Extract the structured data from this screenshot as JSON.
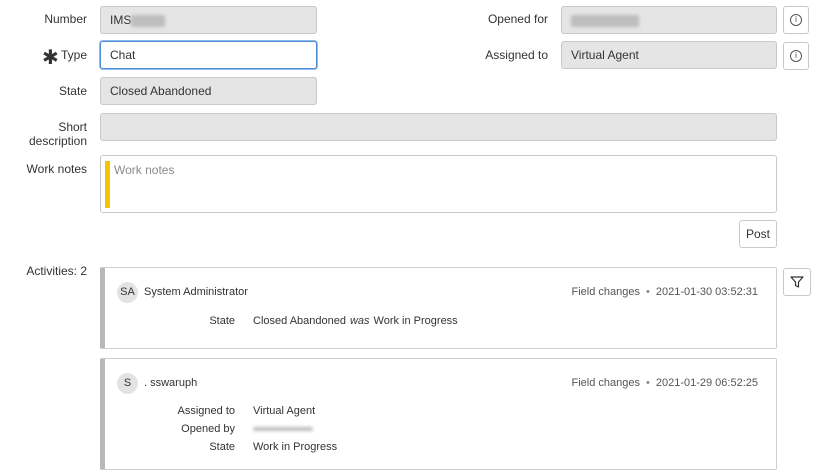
{
  "form": {
    "number": {
      "label": "Number",
      "value": "IMS"
    },
    "type": {
      "label": "Type",
      "value": "Chat",
      "required_mark": "✱"
    },
    "state": {
      "label": "State",
      "value": "Closed Abandoned"
    },
    "opened_for": {
      "label": "Opened for",
      "value": ""
    },
    "assigned_to": {
      "label": "Assigned to",
      "value": "Virtual Agent"
    },
    "short_description": {
      "label": "Short description",
      "value": ""
    },
    "work_notes": {
      "label": "Work notes",
      "placeholder": "Work notes"
    },
    "post_label": "Post"
  },
  "activities": {
    "label": "Activities: 2",
    "entries": [
      {
        "initials": "SA",
        "user": "System Administrator",
        "type": "Field changes",
        "separator": "•",
        "timestamp": "2021-01-30 03:52:31",
        "changes": [
          {
            "field": "State",
            "new": "Closed Abandoned",
            "connector": "was",
            "old": "Work in Progress"
          }
        ]
      },
      {
        "initials": "S",
        "user": ". sswaruph",
        "type": "Field changes",
        "separator": "•",
        "timestamp": "2021-01-29 06:52:25",
        "changes": [
          {
            "field": "Assigned to",
            "new": "Virtual Agent"
          },
          {
            "field": "Opened by",
            "new": ""
          },
          {
            "field": "State",
            "new": "Work in Progress"
          }
        ]
      }
    ]
  },
  "icons": {
    "info": "info-icon",
    "filter": "filter-icon"
  },
  "colors": {
    "focus_border": "#4f8fd6",
    "work_notes_bar": "#f5c400",
    "field_bg": "#e5e5e5"
  }
}
